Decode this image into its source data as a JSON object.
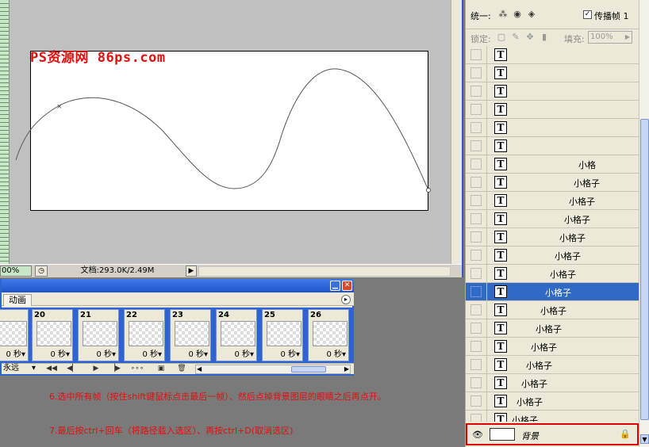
{
  "document": {
    "watermark": "PS资源网 86ps.com",
    "status": {
      "zoom": "00%",
      "doc_info": "文档:293.0K/2.49M",
      "arrow": "▶",
      "status_icon": "◷"
    }
  },
  "animation_panel": {
    "tab": "动画",
    "minimize_glyph": "▁",
    "close_glyph": "✕",
    "menu_glyph": "▸",
    "frames": [
      {
        "number": "",
        "delay": "0 秒▾"
      },
      {
        "number": "20",
        "delay": "0 秒▾"
      },
      {
        "number": "21",
        "delay": "0 秒▾"
      },
      {
        "number": "22",
        "delay": "0 秒▾"
      },
      {
        "number": "23",
        "delay": "0 秒▾"
      },
      {
        "number": "24",
        "delay": "0 秒▾"
      },
      {
        "number": "25",
        "delay": "0 秒▾"
      },
      {
        "number": "26",
        "delay": "0 秒▾"
      }
    ],
    "loop": "永远",
    "loop_arrow": "▾",
    "controls": {
      "first": "◀◀",
      "prev": "◀▏",
      "play": "▶",
      "next": "▕▶",
      "tween": "∘∘∘",
      "new_frame": "▣",
      "delete": "🗑",
      "scroll_left": "◀",
      "scroll_right": "▶"
    }
  },
  "instructions": {
    "step6": "6.选中所有帧（按住shift键鼠标点击最后一帧）、然后点掉背景图层的眼睛之后再点开。",
    "step7": "7.最后按ctrl+回车（将路径载入选区）、再按ctrl+D(取消选区)"
  },
  "layers_panel": {
    "unify_label": "统一:",
    "propagate_label": "传播帧 1",
    "propagate_checked": "✓",
    "lock_label": "锁定:",
    "fill_label": "填充:",
    "fill_value": "100%",
    "fill_arrow": "▶",
    "type_icon": "T",
    "layers": [
      {
        "name": ""
      },
      {
        "name": ""
      },
      {
        "name": ""
      },
      {
        "name": ""
      },
      {
        "name": ""
      },
      {
        "name": ""
      },
      {
        "name": "小格"
      },
      {
        "name": "小格子"
      },
      {
        "name": "小格子"
      },
      {
        "name": "小格子"
      },
      {
        "name": "小格子"
      },
      {
        "name": "小格子"
      },
      {
        "name": "小格子"
      },
      {
        "name": "小格子",
        "selected": true
      },
      {
        "name": "小格子"
      },
      {
        "name": "小格子"
      },
      {
        "name": "小格子"
      },
      {
        "name": "小格子"
      },
      {
        "name": "小格子"
      },
      {
        "name": "小格子"
      },
      {
        "name": "小格子"
      }
    ],
    "background": {
      "name": "背景",
      "eye": "👁",
      "lock": "🔒"
    },
    "scroll_down": "▼"
  },
  "colors": {
    "accent_blue": "#316ac5",
    "instruction_red": "#e01010",
    "highlight_red": "#e00000"
  }
}
